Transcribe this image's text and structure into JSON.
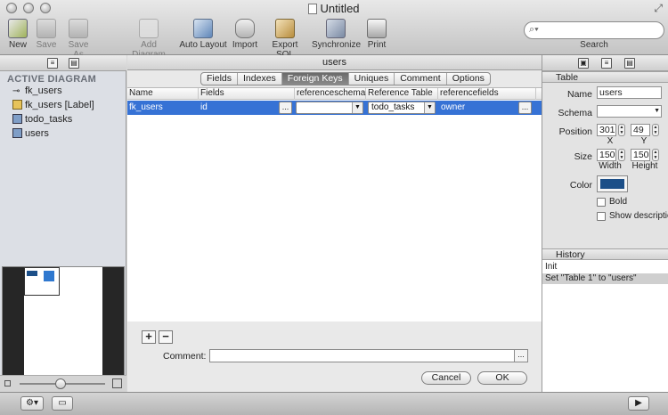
{
  "window": {
    "title": "Untitled"
  },
  "toolbar": {
    "items": [
      {
        "label": "New",
        "icon": "new-icon"
      },
      {
        "label": "Save",
        "icon": "save-icon"
      },
      {
        "label": "Save As",
        "icon": "save-as-icon"
      },
      {
        "label": "Add Diagram",
        "icon": "add-diagram-icon"
      },
      {
        "label": "Auto Layout",
        "icon": "auto-layout-icon"
      },
      {
        "label": "Import",
        "icon": "import-icon"
      },
      {
        "label": "Export SQL",
        "icon": "export-sql-icon"
      },
      {
        "label": "Synchronize",
        "icon": "synchronize-icon"
      },
      {
        "label": "Print",
        "icon": "print-icon"
      }
    ],
    "search_label": "Search"
  },
  "sidebar": {
    "heading": "ACTIVE DIAGRAM",
    "items": [
      {
        "label": "fk_users",
        "icon": "relation-icon"
      },
      {
        "label": "fk_users [Label]",
        "icon": "label-icon"
      },
      {
        "label": "todo_tasks",
        "icon": "table-icon"
      },
      {
        "label": "users",
        "icon": "table-icon"
      }
    ]
  },
  "editor": {
    "title": "users",
    "tabs": [
      "Fields",
      "Indexes",
      "Foreign Keys",
      "Uniques",
      "Comment",
      "Options"
    ],
    "selected_tab": "Foreign Keys",
    "columns": [
      "Name",
      "Fields",
      "referenceschema",
      "Reference Table",
      "referencefields"
    ],
    "rows": [
      {
        "name": "fk_users",
        "fields": "id",
        "referenceschema": "",
        "reference_table": "todo_tasks",
        "referencefields": "owner"
      }
    ],
    "add_label": "+",
    "remove_label": "−",
    "comment_label": "Comment:",
    "comment_value": "",
    "cancel_label": "Cancel",
    "ok_label": "OK",
    "ellipsis": "..."
  },
  "inspector": {
    "section": "Table",
    "name_label": "Name",
    "name_value": "users",
    "schema_label": "Schema",
    "schema_value": "",
    "position_label": "Position",
    "position_x": "301",
    "position_y": "49",
    "x_label": "X",
    "y_label": "Y",
    "size_label": "Size",
    "width": "150",
    "height": "150",
    "width_label": "Width",
    "height_label": "Height",
    "color_label": "Color",
    "color_value": "#1c4f88",
    "bold_label": "Bold",
    "show_description_label": "Show description"
  },
  "history": {
    "heading": "History",
    "items": [
      "Init",
      "Set \"Table 1\" to \"users\""
    ]
  },
  "colors": {
    "selection": "#3672d5",
    "accent_blue": "#1c4f88"
  }
}
